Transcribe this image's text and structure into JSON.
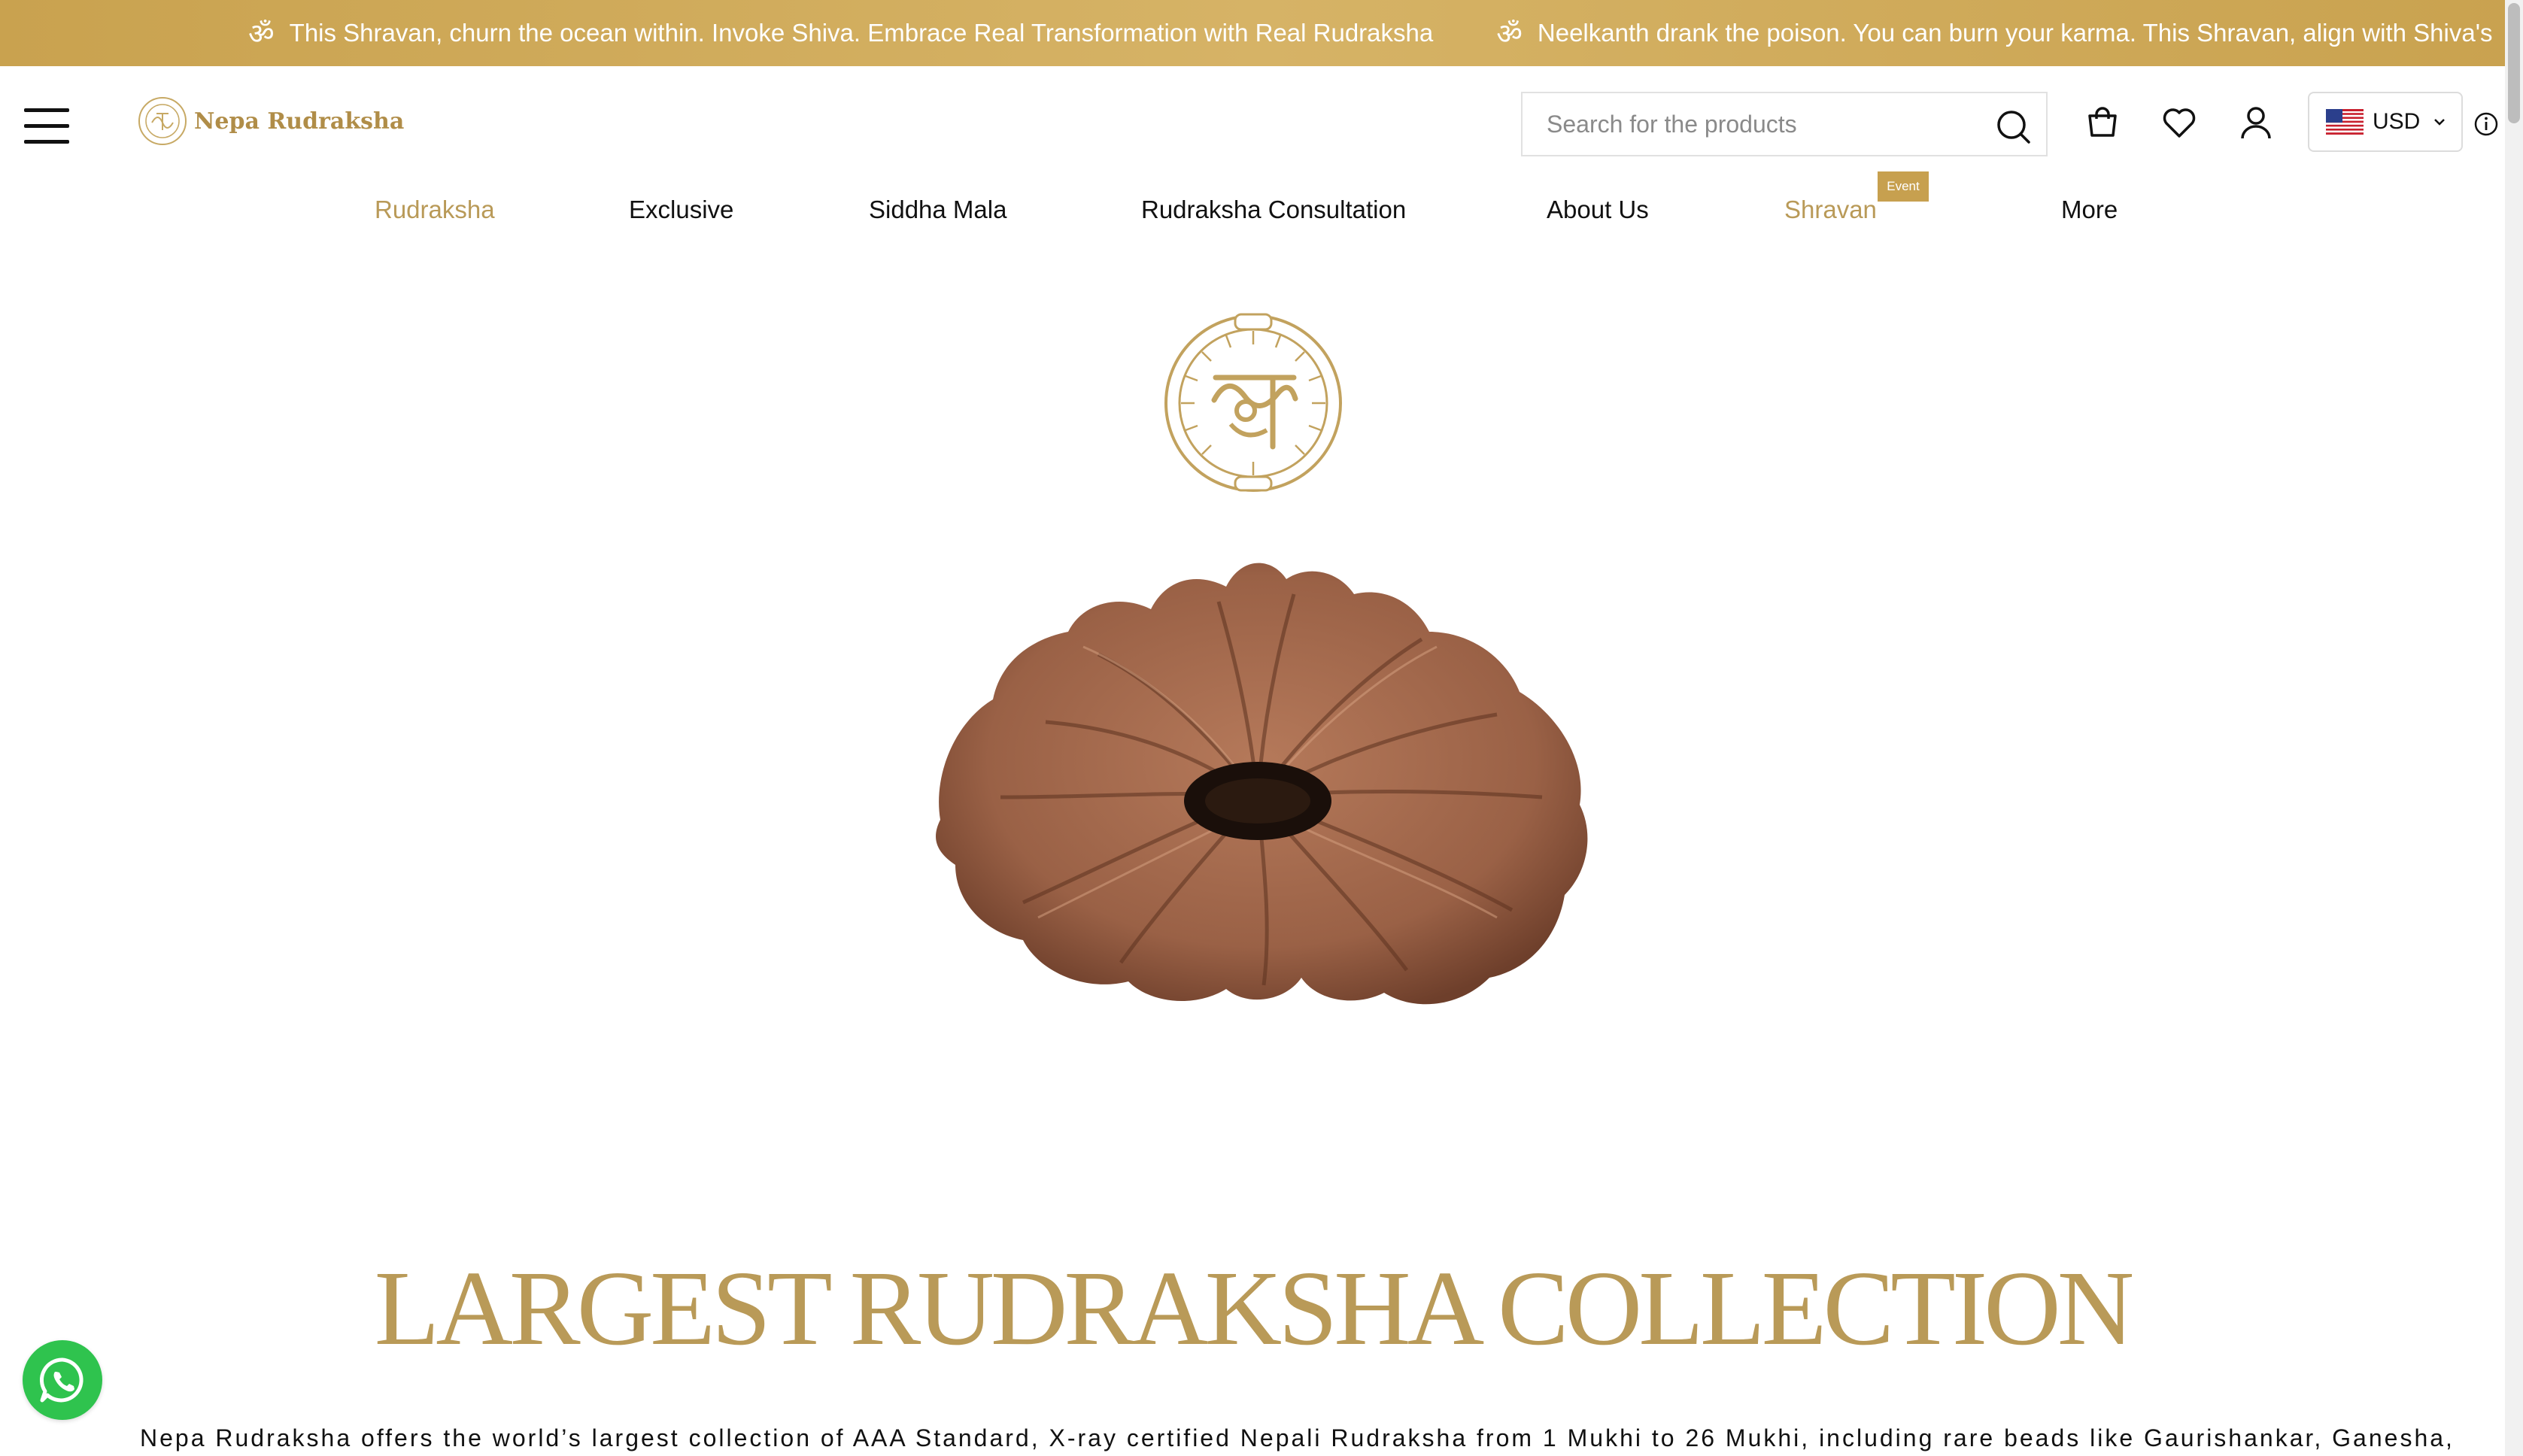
{
  "announcement": {
    "items": [
      {
        "icon": "om-icon",
        "symbol": "ॐ",
        "text": "This Shravan, churn the ocean within. Invoke Shiva. Embrace Real Transformation with Real Rudraksha"
      },
      {
        "icon": "om-icon",
        "symbol": "ॐ",
        "text": "Neelkanth drank the poison. You can burn your karma. This Shravan, align with Shiva's"
      }
    ]
  },
  "header": {
    "logo_text": "Nepa Rudraksha",
    "search": {
      "placeholder": "Search for the products"
    },
    "currency": {
      "label": "USD"
    },
    "icons": [
      "menu-icon",
      "search-icon",
      "cart-icon",
      "wishlist-heart-icon",
      "account-icon",
      "us-flag-icon",
      "chevron-down-icon",
      "info-icon"
    ]
  },
  "nav": {
    "items": [
      {
        "label": "Rudraksha",
        "active": true
      },
      {
        "label": "Exclusive"
      },
      {
        "label": "Siddha Mala"
      },
      {
        "label": "Rudraksha Consultation"
      },
      {
        "label": "About Us"
      },
      {
        "label": "Shravan",
        "badge": "Event",
        "highlight": true
      },
      {
        "label": "More"
      }
    ]
  },
  "hero": {
    "title": "LARGEST RUDRAKSHA COLLECTION",
    "description": "Nepa Rudraksha offers the world’s largest collection of AAA Standard, X-ray certified Nepali Rudraksha from 1 Mukhi to 26 Mukhi, including rare beads like Gaurishankar, Ganesha,"
  },
  "colors": {
    "gold": "#b99a58",
    "announce_bg": "#d3af61",
    "whatsapp_green": "#2fc34e",
    "text": "#111111"
  }
}
